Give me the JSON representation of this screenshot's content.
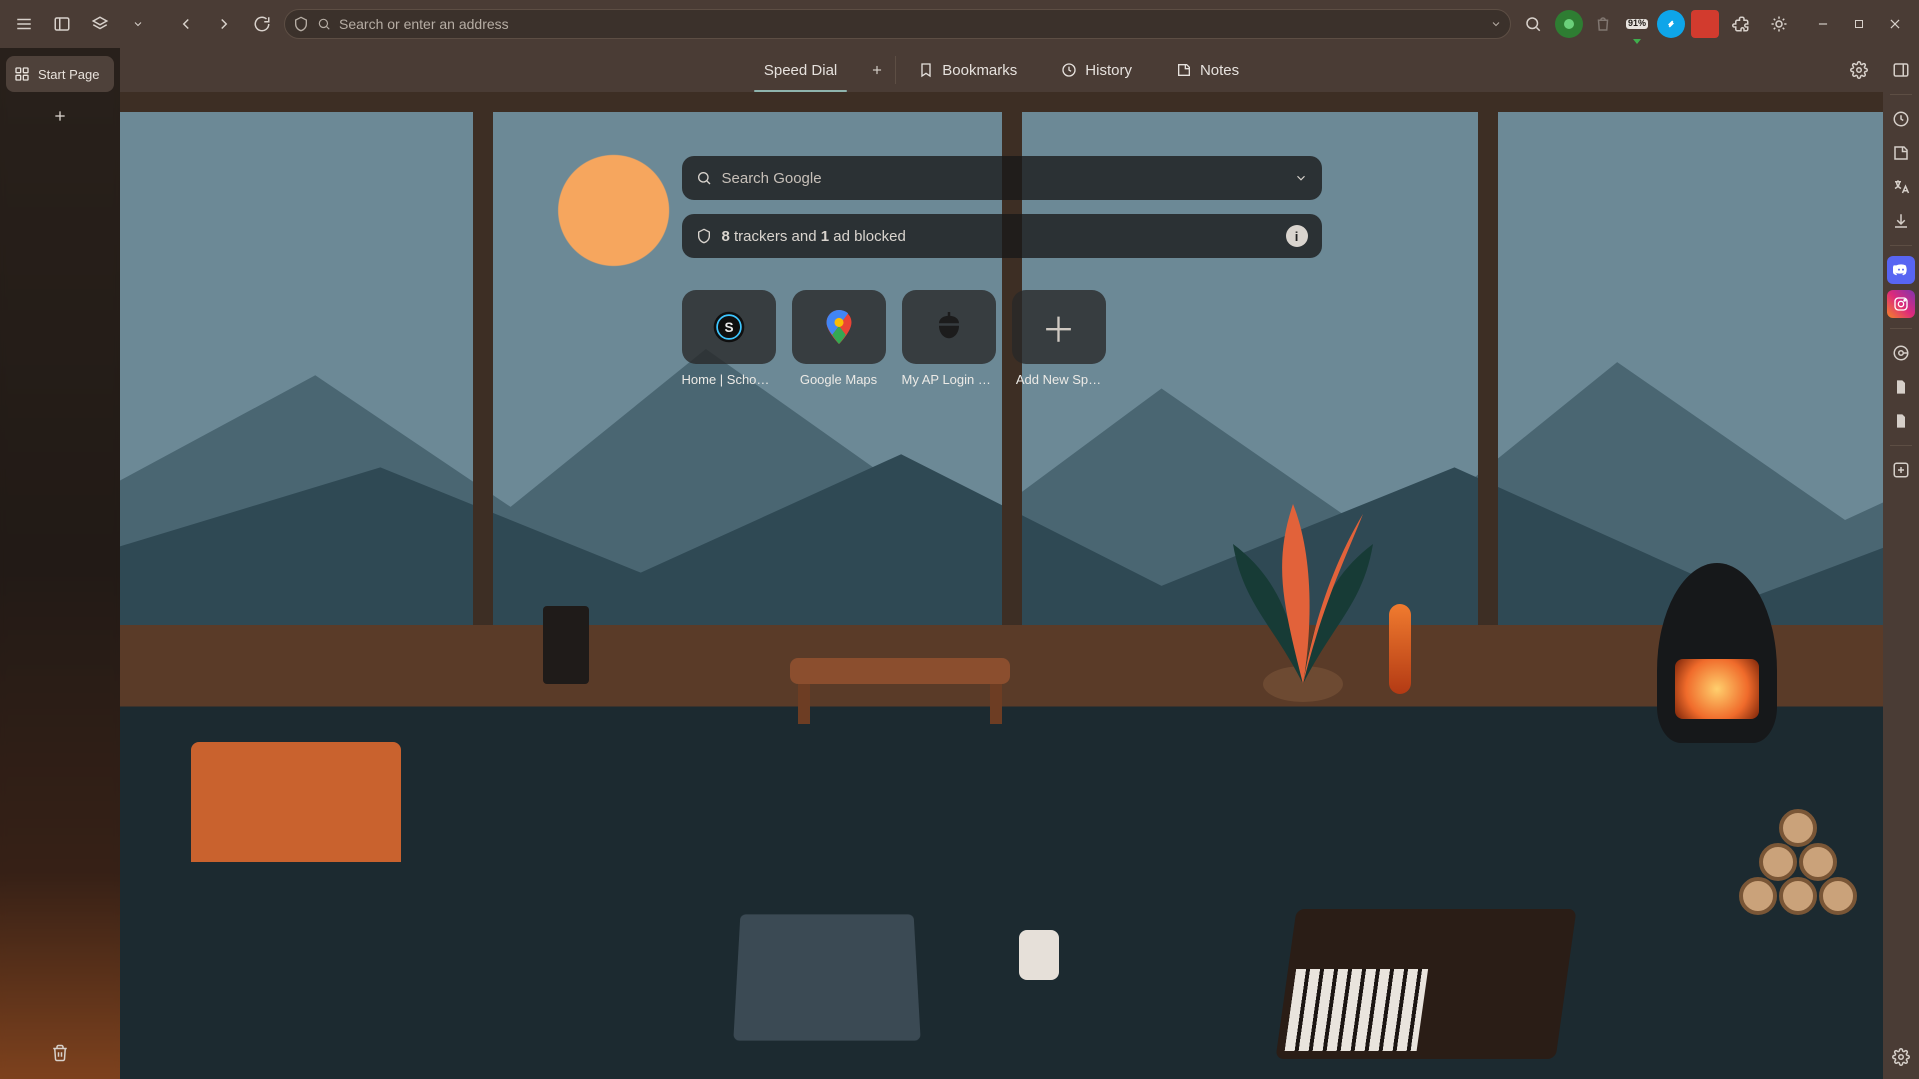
{
  "titlebar": {
    "address_placeholder": "Search or enter an address",
    "battery_badge": "91%"
  },
  "tabstrip": {
    "active_tab_label": "Start Page"
  },
  "nav": {
    "speed_dial": "Speed Dial",
    "bookmarks": "Bookmarks",
    "history": "History",
    "notes": "Notes"
  },
  "start": {
    "search_placeholder": "Search Google",
    "blocker": {
      "trackers": "8",
      "mid1": " trackers and ",
      "ads": "1",
      "mid2": " ad blocked"
    },
    "dials": [
      {
        "label": "Home | Schoology"
      },
      {
        "label": "Google Maps"
      },
      {
        "label": "My AP Login – C…"
      },
      {
        "label": "Add New Sp…"
      }
    ]
  },
  "colors": {
    "accent": "#8fb4ad",
    "chrome": "#4a3c35",
    "ui_dark": "#181818"
  }
}
